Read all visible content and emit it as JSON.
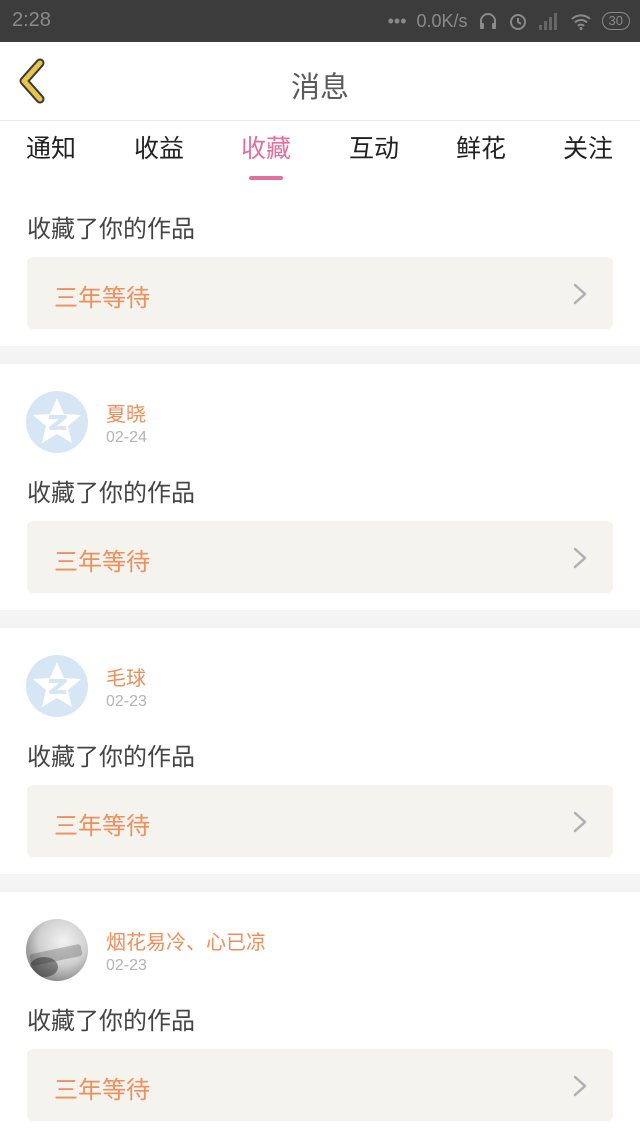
{
  "status_bar": {
    "time": "2:28",
    "dots": "•••",
    "network_speed": "0.0K/s",
    "battery": "30",
    "icons": [
      "headphones-icon",
      "alarm-icon",
      "signal-icon",
      "wifi-icon",
      "battery-icon"
    ]
  },
  "header": {
    "title": "消息",
    "back_icon": "chevron-left-icon"
  },
  "tabs": [
    {
      "label": "通知",
      "active": false
    },
    {
      "label": "收益",
      "active": false
    },
    {
      "label": "收藏",
      "active": true
    },
    {
      "label": "互动",
      "active": false
    },
    {
      "label": "鲜花",
      "active": false
    },
    {
      "label": "关注",
      "active": false
    }
  ],
  "messages": [
    {
      "user": "",
      "date": "",
      "text": "收藏了你的作品",
      "work": "三年等待"
    },
    {
      "user": "夏晓",
      "date": "02-24",
      "text": "收藏了你的作品",
      "work": "三年等待"
    },
    {
      "user": "毛球",
      "date": "02-23",
      "text": "收藏了你的作品",
      "work": "三年等待"
    },
    {
      "user": "烟花易冷、心已凉",
      "date": "02-23",
      "text": "收藏了你的作品",
      "work": "三年等待"
    }
  ],
  "colors": {
    "accent": "#e36ea0",
    "orange": "#ee8f5c",
    "back_icon": "#e9c64a"
  }
}
